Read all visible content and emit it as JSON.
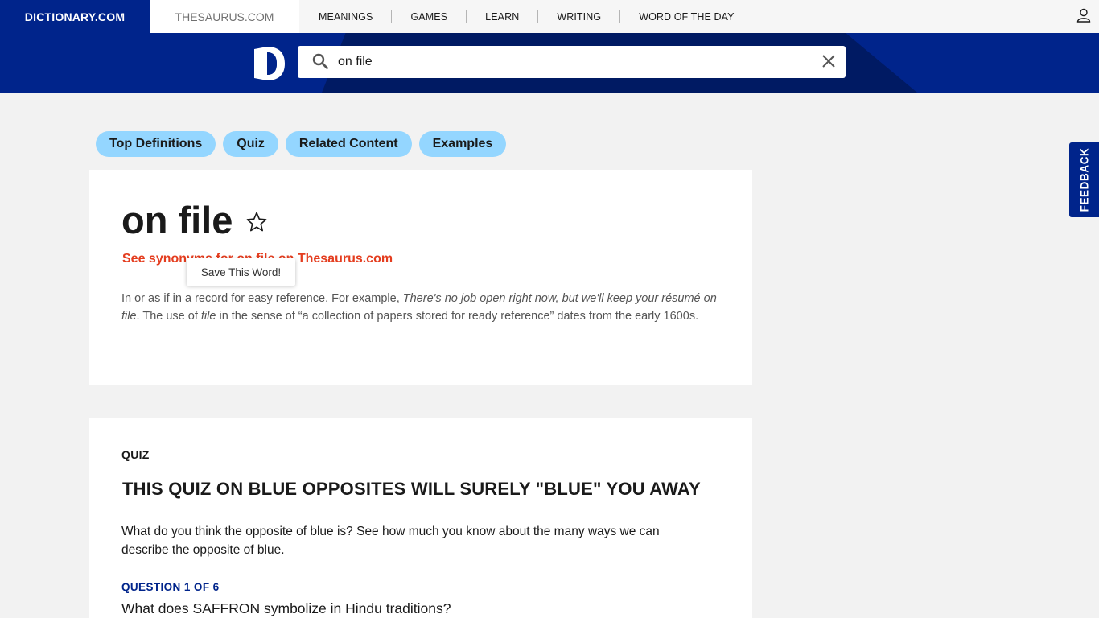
{
  "nav": {
    "brand": "DICTIONARY.COM",
    "thesaurus": "THESAURUS.COM",
    "links": [
      "MEANINGS",
      "GAMES",
      "LEARN",
      "WRITING",
      "WORD OF THE DAY"
    ]
  },
  "search": {
    "value": "on file"
  },
  "pills": [
    "Top Definitions",
    "Quiz",
    "Related Content",
    "Examples"
  ],
  "entry": {
    "headword": "on file",
    "synonyms_link": "See synonyms for on file on Thesaurus.com",
    "tooltip": "Save This Word!",
    "definition": {
      "p1": "In or as if in a record for easy reference. For example, ",
      "ex1": "There's no job open right now, but we'll keep your résumé on file",
      "p2": ". The use of ",
      "ex2": "file",
      "p3": " in the sense of “a collection of papers stored for ready reference” dates from the early 1600s."
    }
  },
  "quiz": {
    "label": "QUIZ",
    "title": "THIS QUIZ ON BLUE OPPOSITES WILL SURELY \"BLUE\" YOU AWAY",
    "description": "What do you think the opposite of blue is? See how much you know about the many ways we can describe the opposite of blue.",
    "question_number": "QUESTION 1 OF 6",
    "question": "What does SAFFRON symbolize in Hindu traditions?"
  },
  "feedback": "FEEDBACK",
  "colors": {
    "brand_blue": "#00248b",
    "pill_blue": "#94d6ff",
    "link_red": "#e43d1f"
  }
}
